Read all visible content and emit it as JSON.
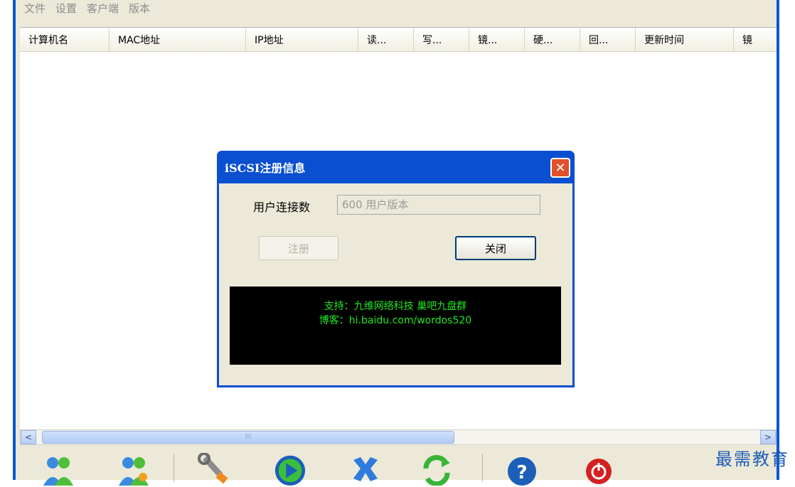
{
  "menu": [
    "文件",
    "设置",
    "客户端",
    "版本"
  ],
  "columns": [
    "计算机名",
    "MAC地址",
    "IP地址",
    "读...",
    "写...",
    "镜...",
    "硬...",
    "回...",
    "更新时间",
    "镜"
  ],
  "scrollbar": {
    "left_arrow": "<",
    "right_arrow": ">",
    "thumb_grip": "III"
  },
  "dialog": {
    "title": "iSCSI注册信息",
    "close_glyph": "✕",
    "user_count_label": "用户连接数",
    "user_count_value": "600 用户版本",
    "register_button": "注册",
    "close_button": "关闭",
    "support_line": "支持：九维网络科技 巢吧九盘群",
    "blog_line": "博客：hi.baidu.com/wordos520"
  },
  "watermark": "最需教育",
  "colors": {
    "title_bar": "#0a4fd0",
    "info_text": "#22e622"
  }
}
